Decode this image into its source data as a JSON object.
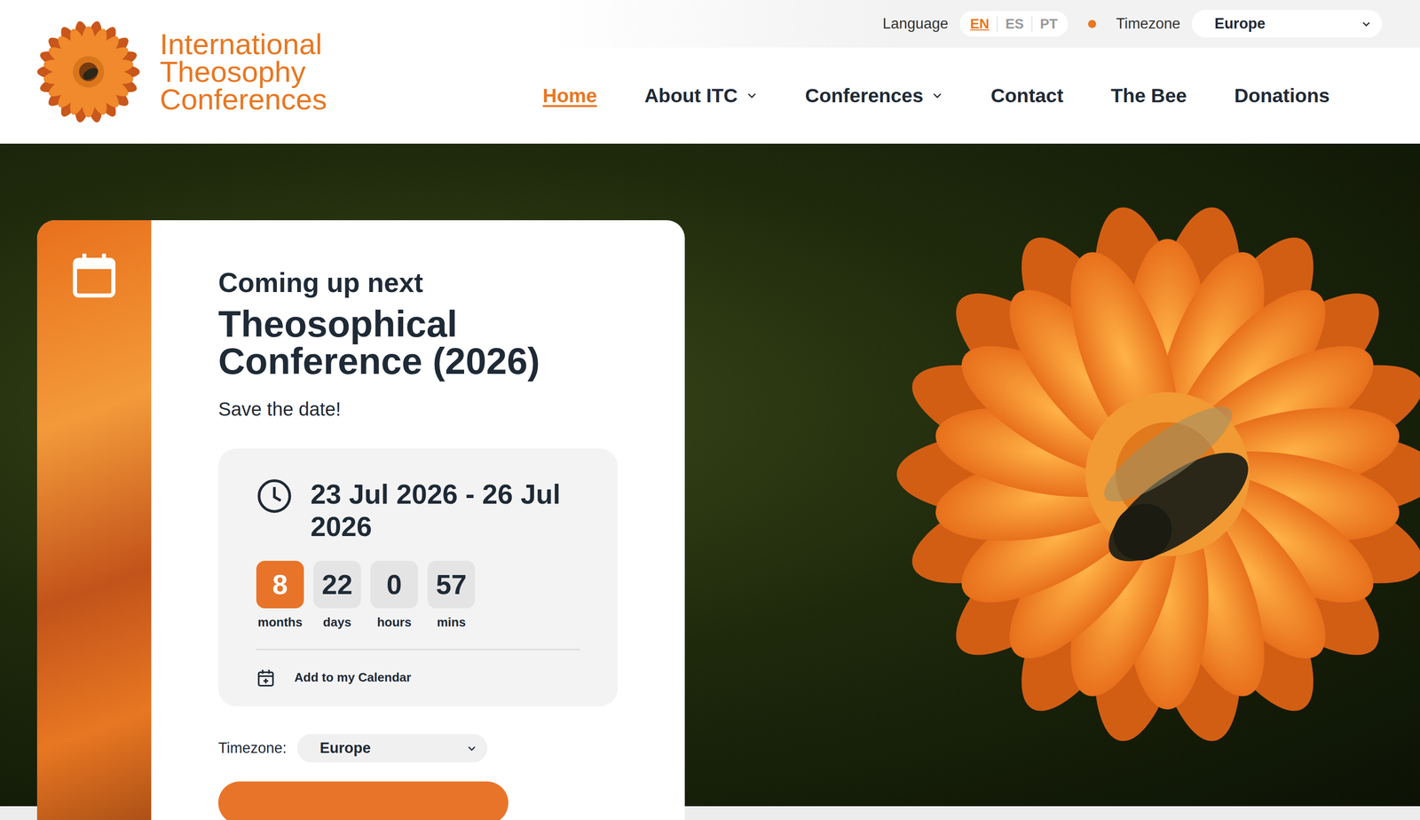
{
  "logo": {
    "lines": [
      "International",
      "Theosophy",
      "Conferences"
    ]
  },
  "topbar": {
    "language_label": "Language",
    "languages": [
      {
        "code": "EN",
        "selected": true
      },
      {
        "code": "ES",
        "selected": false
      },
      {
        "code": "PT",
        "selected": false
      }
    ],
    "timezone_label": "Timezone",
    "timezone_value": "Europe"
  },
  "nav": [
    {
      "label": "Home",
      "selected": true,
      "dropdown": false
    },
    {
      "label": "About ITC",
      "selected": false,
      "dropdown": true
    },
    {
      "label": "Conferences",
      "selected": false,
      "dropdown": true
    },
    {
      "label": "Contact",
      "selected": false,
      "dropdown": false
    },
    {
      "label": "The Bee",
      "selected": false,
      "dropdown": false
    },
    {
      "label": "Donations",
      "selected": false,
      "dropdown": false
    }
  ],
  "event": {
    "eyebrow": "Coming up next",
    "title": "Theosophical Conference (2026)",
    "subtitle": "Save the date!",
    "dates": "23 Jul 2026 - 26 Jul 2026",
    "countdown": [
      {
        "value": "8",
        "unit": "months",
        "highlighted": true
      },
      {
        "value": "22",
        "unit": "days",
        "highlighted": false
      },
      {
        "value": "0",
        "unit": "hours",
        "highlighted": false
      },
      {
        "value": "57",
        "unit": "mins",
        "highlighted": false
      }
    ],
    "calendar_link": "Add to my Calendar",
    "timezone_label": "Timezone:",
    "timezone_value": "Europe"
  }
}
